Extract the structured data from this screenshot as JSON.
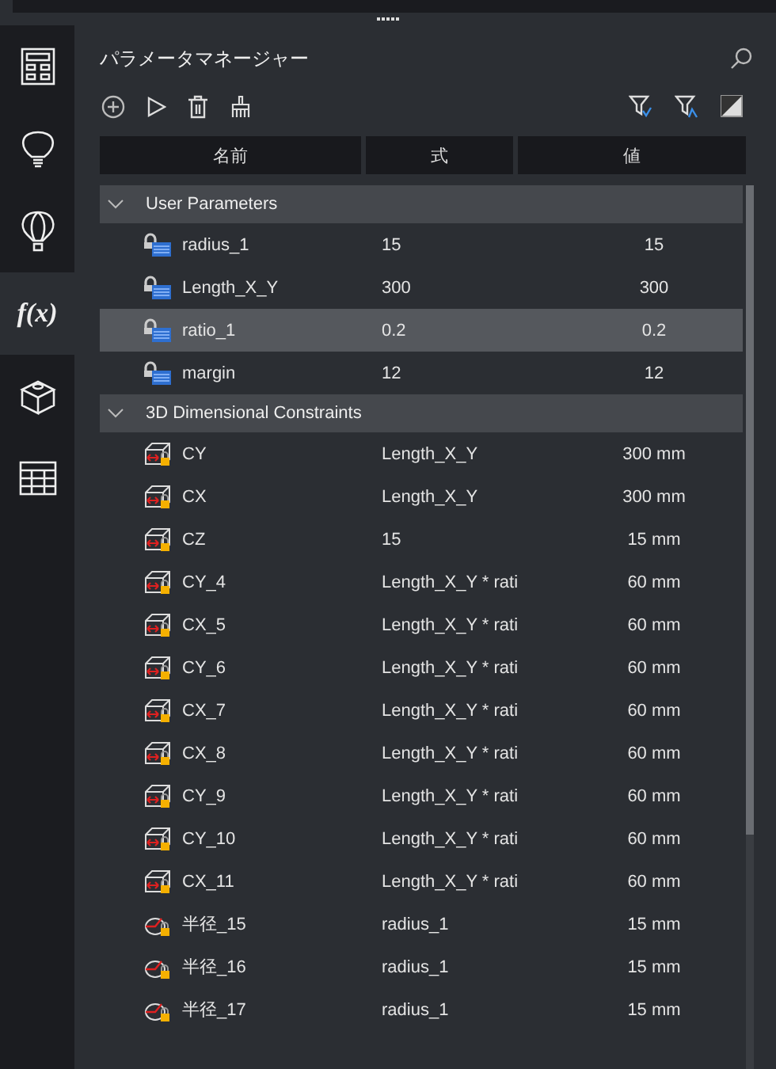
{
  "sidebar": {
    "items": [
      {
        "kind": "layout",
        "selected": false
      },
      {
        "kind": "bulb",
        "selected": false
      },
      {
        "kind": "balloon",
        "selected": false
      },
      {
        "kind": "function",
        "label": "f(x)",
        "selected": true
      },
      {
        "kind": "cube",
        "selected": false
      },
      {
        "kind": "table",
        "selected": false
      }
    ]
  },
  "panel": {
    "title": "パラメータマネージャー"
  },
  "table": {
    "columns": [
      "名前",
      "式",
      "値"
    ],
    "groups": [
      {
        "label": "User Parameters",
        "expanded": true,
        "rows": [
          {
            "kind": "user",
            "name": "radius_1",
            "formula": "15",
            "value": "15",
            "selected": false
          },
          {
            "kind": "user",
            "name": "Length_X_Y",
            "formula": "300",
            "value": "300",
            "selected": false
          },
          {
            "kind": "user",
            "name": "ratio_1",
            "formula": "0.2",
            "value": "0.2",
            "selected": true
          },
          {
            "kind": "user",
            "name": "margin",
            "formula": "12",
            "value": "12",
            "selected": false
          }
        ]
      },
      {
        "label": "3D Dimensional Constraints",
        "expanded": true,
        "rows": [
          {
            "kind": "linear",
            "name": "CY",
            "formula": "Length_X_Y",
            "value": "300 mm",
            "selected": false
          },
          {
            "kind": "linear",
            "name": "CX",
            "formula": "Length_X_Y",
            "value": "300 mm",
            "selected": false
          },
          {
            "kind": "linear",
            "name": "CZ",
            "formula": "15",
            "value": "15 mm",
            "selected": false
          },
          {
            "kind": "linear",
            "name": "CY_4",
            "formula": "Length_X_Y * rati",
            "value": "60 mm",
            "selected": false
          },
          {
            "kind": "linear",
            "name": "CX_5",
            "formula": "Length_X_Y * rati",
            "value": "60 mm",
            "selected": false
          },
          {
            "kind": "linear",
            "name": "CY_6",
            "formula": "Length_X_Y * rati",
            "value": "60 mm",
            "selected": false
          },
          {
            "kind": "linear",
            "name": "CX_7",
            "formula": "Length_X_Y * rati",
            "value": "60 mm",
            "selected": false
          },
          {
            "kind": "linear",
            "name": "CX_8",
            "formula": "Length_X_Y * rati",
            "value": "60 mm",
            "selected": false
          },
          {
            "kind": "linear",
            "name": "CY_9",
            "formula": "Length_X_Y * rati",
            "value": "60 mm",
            "selected": false
          },
          {
            "kind": "linear",
            "name": "CY_10",
            "formula": "Length_X_Y * rati",
            "value": "60 mm",
            "selected": false
          },
          {
            "kind": "linear",
            "name": "CX_11",
            "formula": "Length_X_Y * rati",
            "value": "60 mm",
            "selected": false
          },
          {
            "kind": "radius",
            "name": "半径_15",
            "formula": "radius_1",
            "value": "15 mm",
            "selected": false
          },
          {
            "kind": "radius",
            "name": "半径_16",
            "formula": "radius_1",
            "value": "15 mm",
            "selected": false
          },
          {
            "kind": "radius",
            "name": "半径_17",
            "formula": "radius_1",
            "value": "15 mm",
            "selected": false
          }
        ]
      }
    ]
  }
}
